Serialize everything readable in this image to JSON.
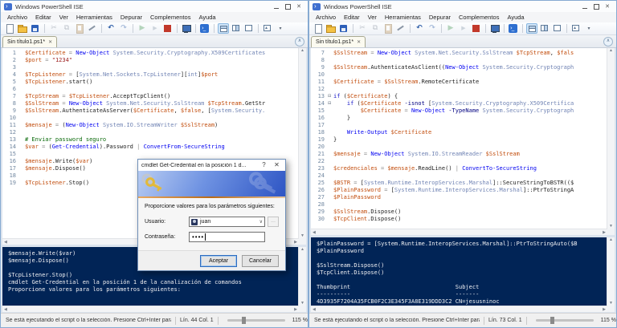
{
  "window_title": "Windows PowerShell ISE",
  "menu": [
    "Archivo",
    "Editar",
    "Ver",
    "Herramientas",
    "Depurar",
    "Complementos",
    "Ayuda"
  ],
  "toolbar": [
    {
      "name": "new-script"
    },
    {
      "name": "open-script"
    },
    {
      "name": "save-script"
    },
    {
      "sep": true
    },
    {
      "name": "cut",
      "disabled": true
    },
    {
      "name": "copy",
      "disabled": true
    },
    {
      "name": "paste",
      "disabled": true
    },
    {
      "name": "clear-console-pane"
    },
    {
      "sep": true
    },
    {
      "name": "undo"
    },
    {
      "name": "redo",
      "disabled": true
    },
    {
      "sep": true
    },
    {
      "name": "run-script",
      "disabled": true
    },
    {
      "name": "run-selection",
      "disabled": true
    },
    {
      "name": "stop-operation"
    },
    {
      "sep": true
    },
    {
      "name": "new-remote-powershell-tab"
    },
    {
      "sep": true
    },
    {
      "name": "start-powershell"
    },
    {
      "sep": true
    },
    {
      "name": "script-pane-top",
      "selected": true
    },
    {
      "name": "script-pane-right"
    },
    {
      "name": "script-pane-maximized"
    },
    {
      "sep": true
    },
    {
      "name": "show-command-window"
    },
    {
      "name": "toolbar-overflow"
    }
  ],
  "tab_label": "Sin título1.ps1*",
  "left": {
    "editor": {
      "lines": [
        {
          "n": 1,
          "segs": [
            [
              "v",
              "$Certificate"
            ],
            [
              "o",
              " = "
            ],
            [
              "c",
              "New-Object"
            ],
            [
              "t",
              " System.Security.Cryptography.X509Certificates"
            ]
          ]
        },
        {
          "n": 2,
          "segs": [
            [
              "v",
              "$port"
            ],
            [
              "o",
              " = "
            ],
            [
              "s",
              "\"1234\""
            ]
          ]
        },
        {
          "n": 3,
          "segs": []
        },
        {
          "n": 4,
          "segs": [
            [
              "v",
              "$TcpListener"
            ],
            [
              "o",
              " = "
            ],
            [
              "b",
              "["
            ],
            [
              "t",
              "System.Net.Sockets.TcpListener"
            ],
            [
              "b",
              "]["
            ],
            [
              "t",
              "int"
            ],
            [
              "b",
              "]"
            ],
            [
              "v",
              "$port"
            ]
          ]
        },
        {
          "n": 5,
          "segs": [
            [
              "v",
              "$TcpListener"
            ],
            [
              "b",
              ".start()"
            ]
          ]
        },
        {
          "n": 6,
          "segs": []
        },
        {
          "n": 7,
          "segs": [
            [
              "v",
              "$TcpStream"
            ],
            [
              "o",
              " = "
            ],
            [
              "v",
              "$TcpListener"
            ],
            [
              "b",
              ".AcceptTcpClient()"
            ]
          ]
        },
        {
          "n": 8,
          "segs": [
            [
              "v",
              "$SslStream"
            ],
            [
              "o",
              " = "
            ],
            [
              "c",
              "New-Object"
            ],
            [
              "t",
              " System.Net.Security.SslStream"
            ],
            [
              "v",
              " $TcpStream"
            ],
            [
              "b",
              ".GetStr"
            ]
          ]
        },
        {
          "n": 9,
          "segs": [
            [
              "v",
              "$SslStream"
            ],
            [
              "b",
              ".AuthenticateAsServer("
            ],
            [
              "v",
              "$Certificate"
            ],
            [
              "b",
              ", "
            ],
            [
              "v",
              "$false"
            ],
            [
              "b",
              ", ["
            ],
            [
              "t",
              "System.Security."
            ]
          ]
        },
        {
          "n": 10,
          "segs": []
        },
        {
          "n": 11,
          "segs": [
            [
              "v",
              "$mensaje"
            ],
            [
              "o",
              " = "
            ],
            [
              "b",
              "("
            ],
            [
              "c",
              "New-Object"
            ],
            [
              "t",
              " System.IO.StreamWriter"
            ],
            [
              "v",
              " $SslStream"
            ],
            [
              "b",
              ")"
            ]
          ]
        },
        {
          "n": 12,
          "segs": []
        },
        {
          "n": 13,
          "segs": [
            [
              "m",
              "# Enviar password seguro"
            ]
          ]
        },
        {
          "n": 14,
          "segs": [
            [
              "v",
              "$var"
            ],
            [
              "o",
              " = "
            ],
            [
              "b",
              "("
            ],
            [
              "c",
              "Get-Credential"
            ],
            [
              "b",
              ").Password"
            ],
            [
              "o",
              " | "
            ],
            [
              "c",
              "ConvertFrom-SecureString"
            ]
          ]
        },
        {
          "n": 15,
          "segs": []
        },
        {
          "n": 16,
          "segs": [
            [
              "v",
              "$mensaje"
            ],
            [
              "b",
              ".Write("
            ],
            [
              "v",
              "$var"
            ],
            [
              "b",
              ")"
            ]
          ]
        },
        {
          "n": 17,
          "segs": [
            [
              "v",
              "$mensaje"
            ],
            [
              "b",
              ".Dispose()"
            ]
          ]
        },
        {
          "n": 18,
          "segs": []
        },
        {
          "n": 19,
          "segs": [
            [
              "v",
              "$TcpListener"
            ],
            [
              "b",
              ".Stop()"
            ]
          ]
        }
      ]
    },
    "console": {
      "lines": [
        "$mensaje.Write($var)",
        "$mensaje.Dispose()",
        "",
        "$TcpListener.Stop()",
        "cmdlet Get-Credential en la posición 1 de la canalización de comandos",
        "Proporcione valores para los parámetros siguientes:"
      ]
    },
    "status": {
      "message": "Se está ejecutando el script o la selección. Presione Ctrl+Inter para det",
      "position": "Lín. 44 Col. 1",
      "zoom": "115 %"
    }
  },
  "right": {
    "editor": {
      "lines": [
        {
          "n": 7,
          "segs": [
            [
              "v",
              "$SslStream"
            ],
            [
              "o",
              " = "
            ],
            [
              "c",
              "New-Object"
            ],
            [
              "t",
              " System.Net.Security.SslStream"
            ],
            [
              "v",
              " $TcpStream"
            ],
            [
              "b",
              ","
            ],
            [
              "v",
              " $fals"
            ]
          ]
        },
        {
          "n": 8,
          "segs": []
        },
        {
          "n": 9,
          "segs": [
            [
              "v",
              "$SslStream"
            ],
            [
              "b",
              ".AuthenticateAsClient(("
            ],
            [
              "c",
              "New-Object"
            ],
            [
              "t",
              " System.Security.Cryptograph"
            ]
          ]
        },
        {
          "n": 10,
          "segs": []
        },
        {
          "n": 11,
          "segs": [
            [
              "v",
              "$Certificate"
            ],
            [
              "o",
              " = "
            ],
            [
              "v",
              "$SslStream"
            ],
            [
              "b",
              ".RemoteCertificate"
            ]
          ]
        },
        {
          "n": 12,
          "segs": []
        },
        {
          "n": 13,
          "fold": true,
          "segs": [
            [
              "k",
              "if"
            ],
            [
              "b",
              " ("
            ],
            [
              "v",
              "$Certificate"
            ],
            [
              "b",
              ") {"
            ]
          ]
        },
        {
          "n": 14,
          "fold": true,
          "segs": [
            [
              "b",
              "    "
            ],
            [
              "k",
              "if"
            ],
            [
              "b",
              " ("
            ],
            [
              "v",
              "$Certificate"
            ],
            [
              "p",
              " -isnot"
            ],
            [
              "b",
              " ["
            ],
            [
              "t",
              "System.Security.Cryptography.X509Certifica"
            ]
          ]
        },
        {
          "n": 15,
          "segs": [
            [
              "b",
              "        "
            ],
            [
              "v",
              "$Certificate"
            ],
            [
              "o",
              " = "
            ],
            [
              "c",
              "New-Object"
            ],
            [
              "p",
              " -TypeName"
            ],
            [
              "t",
              " System.Security.Cryptograph"
            ]
          ]
        },
        {
          "n": 16,
          "segs": [
            [
              "b",
              "    }"
            ]
          ]
        },
        {
          "n": 17,
          "segs": []
        },
        {
          "n": 18,
          "segs": [
            [
              "b",
              "    "
            ],
            [
              "c",
              "Write-Output"
            ],
            [
              "v",
              " $Certificate"
            ]
          ]
        },
        {
          "n": 19,
          "segs": [
            [
              "b",
              "}"
            ]
          ]
        },
        {
          "n": 20,
          "segs": []
        },
        {
          "n": 21,
          "segs": [
            [
              "v",
              "$mensaje"
            ],
            [
              "o",
              " = "
            ],
            [
              "c",
              "New-Object"
            ],
            [
              "t",
              " System.IO.StreamReader"
            ],
            [
              "v",
              " $SslStream"
            ]
          ]
        },
        {
          "n": 22,
          "segs": []
        },
        {
          "n": 23,
          "segs": [
            [
              "v",
              "$credenciales"
            ],
            [
              "o",
              " = "
            ],
            [
              "v",
              "$mensaje"
            ],
            [
              "b",
              ".ReadLine()"
            ],
            [
              "o",
              " | "
            ],
            [
              "c",
              "ConvertTo-SecureString"
            ]
          ]
        },
        {
          "n": 24,
          "segs": []
        },
        {
          "n": 25,
          "segs": [
            [
              "v",
              "$BSTR"
            ],
            [
              "o",
              " = "
            ],
            [
              "b",
              "["
            ],
            [
              "t",
              "System.Runtime.InteropServices.Marshal"
            ],
            [
              "b",
              "]::SecureStringToBSTR(($"
            ]
          ]
        },
        {
          "n": 26,
          "segs": [
            [
              "v",
              "$PlainPassword"
            ],
            [
              "o",
              " = "
            ],
            [
              "b",
              "["
            ],
            [
              "t",
              "System.Runtime.InteropServices.Marshal"
            ],
            [
              "b",
              "]::PtrToStringA"
            ]
          ]
        },
        {
          "n": 27,
          "segs": [
            [
              "v",
              "$PlainPassword"
            ]
          ]
        },
        {
          "n": 28,
          "segs": []
        },
        {
          "n": 29,
          "segs": [
            [
              "v",
              "$SslStream"
            ],
            [
              "b",
              ".Dispose()"
            ]
          ]
        },
        {
          "n": 30,
          "segs": [
            [
              "v",
              "$TcpClient"
            ],
            [
              "b",
              ".Dispose()"
            ]
          ]
        }
      ]
    },
    "console": {
      "lines": [
        "$PlainPassword = [System.Runtime.InteropServices.Marshal]::PtrToStringAuto($B",
        "$PlainPassword",
        "",
        "$SslStream.Dispose()",
        "$TcpClient.Dispose()",
        "",
        "Thumbprint                               Subject",
        "----------                               -------",
        "4D3935F7204A35FCB0F2C3E345F3A8E319DDD3C2 CN=jesusninoc"
      ]
    },
    "status": {
      "message": "Se está ejecutando el script o la selección. Presione Ctrl+Inter para det",
      "position": "Lín. 73 Col. 1",
      "zoom": "115 %"
    }
  },
  "dialog": {
    "title": "cmdlet Get-Credential en la posición 1 d...",
    "help_glyph": "?",
    "prompt": "Proporcione valores para los parámetros siguientes:",
    "user_label": "Usuario:",
    "user_value": "juan",
    "password_label": "Contraseña:",
    "password_value": "••••",
    "browse_label": "...",
    "ok_label": "Aceptar",
    "cancel_label": "Cancelar"
  },
  "colors": {
    "console_bg": "#012456",
    "variable": "#C24D0D",
    "cmdlet": "#0000F0",
    "type": "#7285B5",
    "string": "#9B1B1B",
    "comment": "#0A6A0A",
    "operator": "#8A8A8A",
    "parameter": "#000080",
    "stop_red": "#C2392B"
  }
}
